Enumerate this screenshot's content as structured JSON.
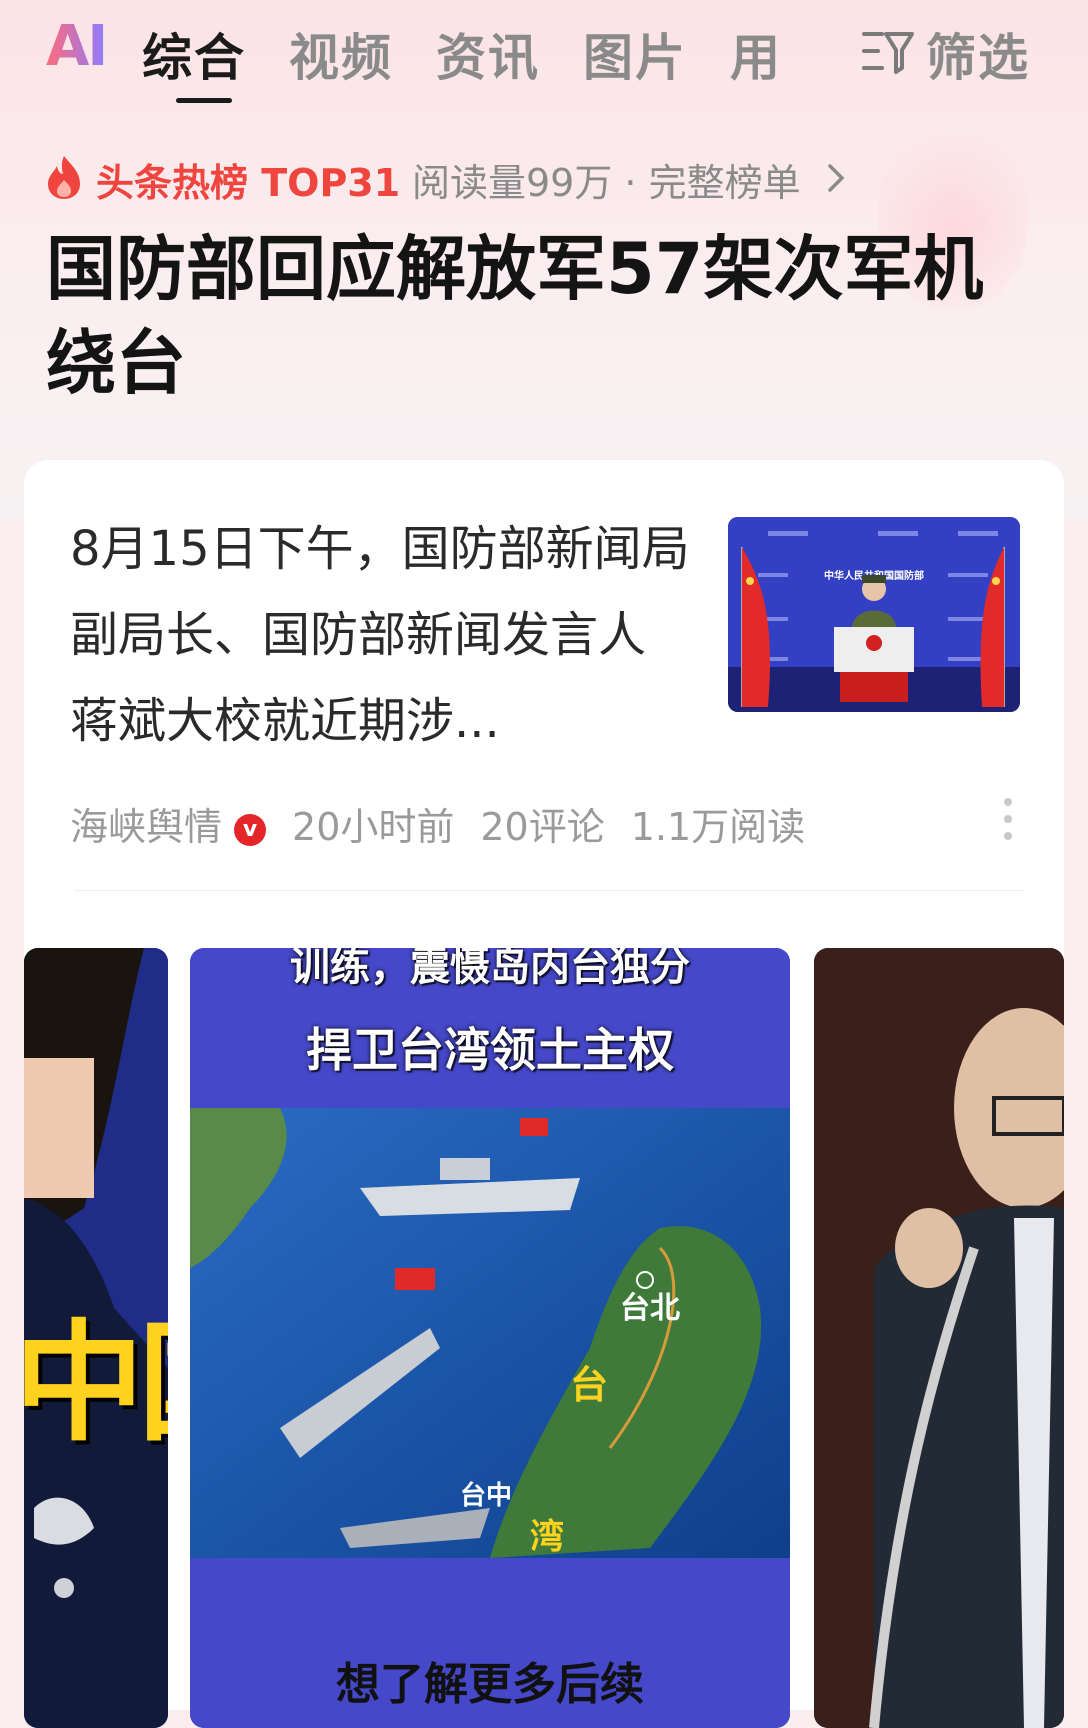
{
  "tabs": {
    "ai_label": "AI",
    "items": [
      {
        "label": "综合",
        "active": true
      },
      {
        "label": "视频",
        "active": false
      },
      {
        "label": "资讯",
        "active": false
      },
      {
        "label": "图片",
        "active": false
      },
      {
        "label": "用",
        "active": false
      }
    ],
    "filter_label": "筛选"
  },
  "hotlist": {
    "label": "头条热榜 TOP31",
    "meta": "阅读量99万 · 完整榜单"
  },
  "headline": "国防部回应解放军57架次军机绕台",
  "card": {
    "summary": "8月15日下午，国防部新闻局副局长、国防部新闻发言人蒋斌大校就近期涉...",
    "source": "海峡舆情",
    "time": "20小时前",
    "comments": "20评论",
    "reads": "1.1万阅读"
  },
  "gallery": {
    "image1_text": "中国",
    "image2_caption_top": "训练，震慑岛内台独分",
    "image2_caption": "捍卫台湾领土主权",
    "image2_map_labels": [
      "台北",
      "台",
      "台中",
      "湾"
    ],
    "image2_bottom": "想了解更多后续"
  },
  "thumb_text": {
    "banner": "中华人民共和国国防部"
  },
  "colors": {
    "accent_red": "#f0453f",
    "text_primary": "#141414",
    "text_secondary": "#8a8a8a"
  },
  "icons": [
    "fire-icon",
    "filter-icon",
    "chevron-right-icon",
    "verified-icon",
    "more-icon"
  ]
}
